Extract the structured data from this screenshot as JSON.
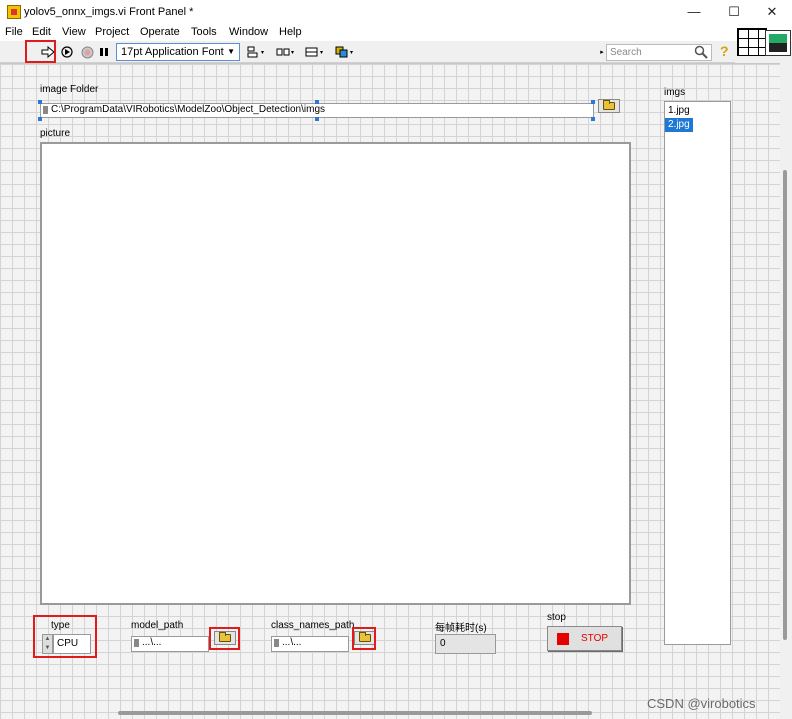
{
  "window": {
    "title": "yolov5_onnx_imgs.vi Front Panel *",
    "minimize_glyph": "—",
    "maximize_glyph": "☐",
    "close_glyph": "✕"
  },
  "menu": [
    "File",
    "Edit",
    "View",
    "Project",
    "Operate",
    "Tools",
    "Window",
    "Help"
  ],
  "toolbar": {
    "run_icon": "run-arrow-icon",
    "font_label": "17pt Application Font",
    "font_arrow": "▼",
    "search_placeholder": "Search",
    "help_glyph": "?"
  },
  "image_folder": {
    "label": "image Folder",
    "value": "C:\\ProgramData\\VIRobotics\\ModelZoo\\Object_Detection\\imgs"
  },
  "picture": {
    "label": "picture"
  },
  "imgs": {
    "label": "imgs",
    "items": [
      "1.jpg",
      "2.jpg"
    ],
    "selected_index": 1
  },
  "type": {
    "label": "type",
    "value": "CPU",
    "up": "▲",
    "down": "▼"
  },
  "model_path": {
    "label": "model_path",
    "value": "...\\..."
  },
  "class_names_path": {
    "label": "class_names_path",
    "value": "...\\..."
  },
  "time": {
    "label": "每帧耗时(s)",
    "value": "0"
  },
  "stop": {
    "label": "stop",
    "button_text": "STOP"
  },
  "watermark": "CSDN @virobotics",
  "colors": {
    "highlight": "#e01b1b",
    "selection": "#1e78d6",
    "stop_red": "#e60000"
  }
}
